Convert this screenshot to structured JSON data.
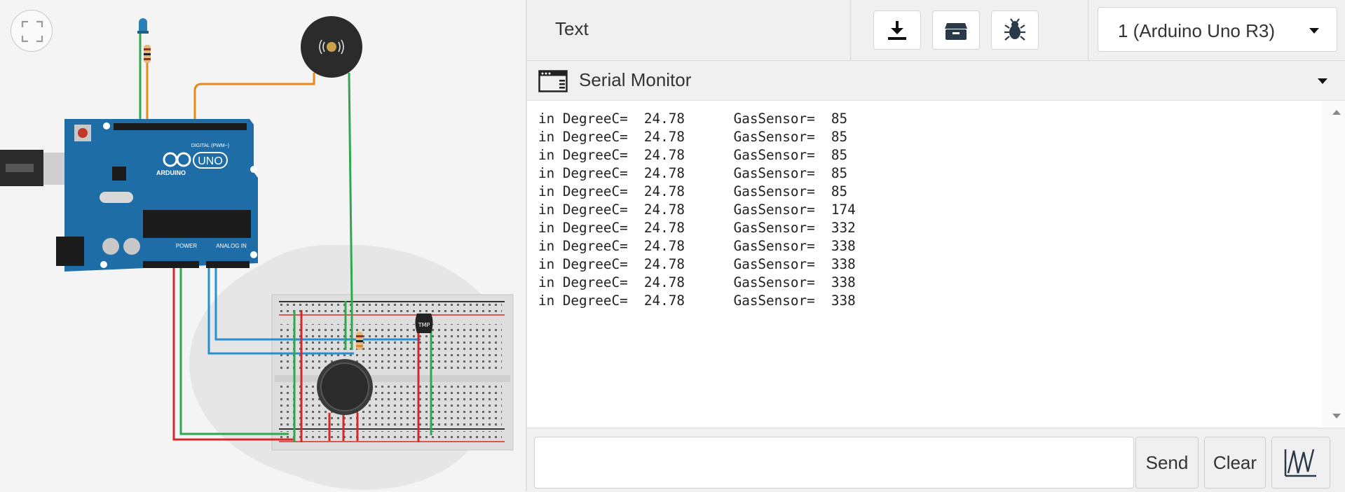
{
  "toolbar": {
    "mode_label": "Text",
    "download_icon": "download-icon",
    "library_icon": "library-box-icon",
    "debug_icon": "bug-icon",
    "device_select": "1 (Arduino Uno R3)"
  },
  "serial_monitor": {
    "title": "Serial Monitor",
    "lines": [
      "in DegreeC=  24.78      GasSensor=  85",
      "in DegreeC=  24.78      GasSensor=  85",
      "in DegreeC=  24.78      GasSensor=  85",
      "in DegreeC=  24.78      GasSensor=  85",
      "in DegreeC=  24.78      GasSensor=  85",
      "in DegreeC=  24.78      GasSensor=  174",
      "in DegreeC=  24.78      GasSensor=  332",
      "in DegreeC=  24.78      GasSensor=  338",
      "in DegreeC=  24.78      GasSensor=  338",
      "in DegreeC=  24.78      GasSensor=  338",
      "in DegreeC=  24.78      GasSensor=  338"
    ],
    "input_value": "",
    "send_label": "Send",
    "clear_label": "Clear",
    "graph_icon": "graph-waveform-icon"
  },
  "canvas": {
    "board_brand": "ARDUINO",
    "board_model": "UNO",
    "board_digital_label": "DIGITAL (PWM~)",
    "board_power_label": "POWER",
    "board_analog_label": "ANALOG IN",
    "sensor_label": "TMP",
    "colors": {
      "board": "#1f6da6",
      "wire_green": "#2fa84f",
      "wire_orange": "#e88a1a",
      "wire_red": "#d22a2a",
      "wire_blue": "#2a8fd0"
    }
  }
}
